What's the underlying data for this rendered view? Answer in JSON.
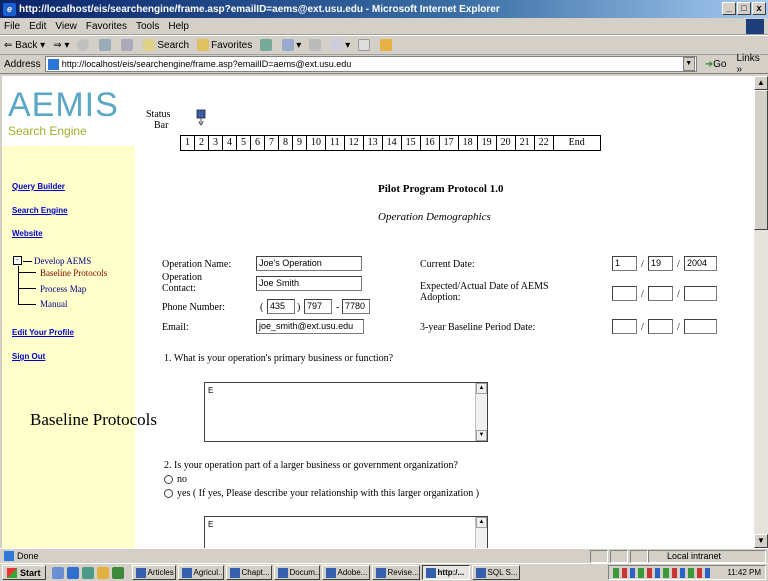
{
  "window": {
    "title": "http://localhost/eis/searchengine/frame.asp?emailID=aems@ext.usu.edu - Microsoft Internet Explorer",
    "controls": [
      "_",
      "Ѐ",
      "x"
    ]
  },
  "menu": [
    "File",
    "Edit",
    "View",
    "Favorites",
    "Tools",
    "Help"
  ],
  "toolbar": {
    "back": "⇐ Back",
    "search": "Search",
    "favorites": "Favorites"
  },
  "address": {
    "label": "Address",
    "url": "http://localhost/eis/searchengine/frame.asp?emailID=aems@ext.usu.edu",
    "go": "Go",
    "links": "Links »"
  },
  "sidebar": {
    "brand": "AEMIS",
    "brand_sub": "Search Engine",
    "links": [
      "Query Builder",
      "Search Engine",
      "Website"
    ],
    "tree_root": "Develop AEMS",
    "tree_children": [
      "Baseline Protocols",
      "Process Map",
      "Manual"
    ],
    "bottom_links": [
      "Edit Your Profile",
      "Sign Out"
    ],
    "section_label": "Baseline Protocols"
  },
  "status_bar": {
    "label_line1": "Status",
    "label_line2": "Bar",
    "steps": [
      "1",
      "2",
      "3",
      "4",
      "5",
      "6",
      "7",
      "8",
      "9",
      "10",
      "11",
      "12",
      "13",
      "14",
      "15",
      "16",
      "17",
      "18",
      "19",
      "20",
      "21",
      "22",
      "End"
    ]
  },
  "page": {
    "title": "Pilot Program Protocol 1.0",
    "subtitle": "Operation Demographics"
  },
  "form": {
    "operation_name_label": "Operation Name:",
    "operation_name": "Joe's Operation",
    "operation_contact_label_1": "Operation",
    "operation_contact_label_2": "Contact:",
    "operation_contact": "Joe Smith",
    "phone_label": "Phone Number:",
    "phone_area": "435",
    "phone_prefix": "797",
    "phone_line": "7780",
    "email_label": "Email:",
    "email": "joe_smith@ext.usu.edu",
    "current_date_label": "Current Date:",
    "current_month": "1",
    "current_day": "19",
    "current_year": "2004",
    "adoption_label_1": "Expected/Actual Date of AEMS",
    "adoption_label_2": "Adoption:",
    "baseline_label": "3-year Baseline Period Date:"
  },
  "questions": {
    "q1": "1. What is your operation's primary business or function?",
    "q1_answer": "E",
    "q2": "2. Is your operation part of a larger business or government organization?",
    "q2_no": "no",
    "q2_yes": "yes ( If yes, Please describe your relationship with this larger organization )",
    "q2_answer": "E"
  },
  "ie_status": {
    "text": "Done",
    "zone": "Local intranet"
  },
  "taskbar": {
    "start": "Start",
    "buttons": [
      "Articles",
      "Agricul...",
      "Chapt...",
      "Docum...",
      "Adobe...",
      "Revise...",
      "http:/...",
      "SQL S..."
    ],
    "clock": "11:42 PM"
  }
}
